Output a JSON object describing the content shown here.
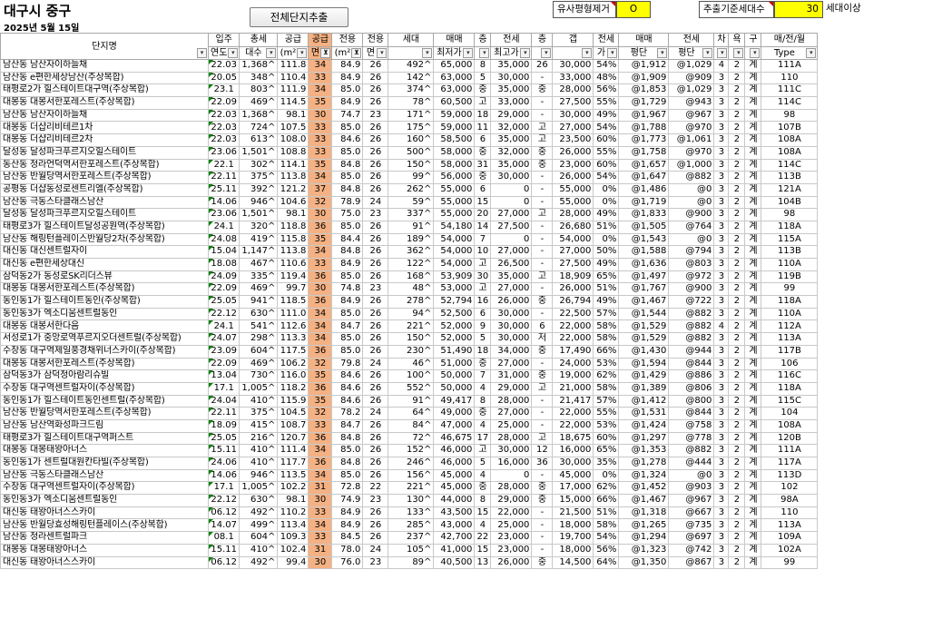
{
  "header": {
    "title": "대구시 중구",
    "date": "2025년 5월 15일",
    "extract_button": "전체단지추출",
    "similar_remove_label": "유사평형제거",
    "similar_remove_value": "O",
    "min_units_label": "추출기준세대수",
    "min_units_value": "30",
    "min_units_unit": "세대이상"
  },
  "colors": {
    "highlight": "#f4b183",
    "yellow": "#ffff00",
    "corner_green": "#008000",
    "corner_red": "#d00000"
  },
  "columns_top": [
    "단지명",
    "입주",
    "총세",
    "공급",
    "공급",
    "전용",
    "전용",
    "세대",
    "매매",
    "층",
    "전세",
    "층",
    "갭",
    "전세",
    "매매",
    "전세",
    "차",
    "욕",
    "구",
    "매/전/월"
  ],
  "columns_bottom": [
    "",
    "연도",
    "대수",
    "(m²",
    "면",
    "(m²",
    "면",
    "",
    "최저가",
    "",
    "최고가",
    "",
    "",
    "가",
    "평단",
    "평단",
    "",
    "",
    "",
    "Type"
  ],
  "rows": [
    [
      "남산동 남산자이하늘채",
      "22.03",
      "1,368^",
      "111.8",
      "34",
      "84.9",
      "26",
      "492^",
      "65,000",
      "8",
      "35,000",
      "26",
      "30,000",
      "54%",
      "@1,912",
      "@1,029",
      "4",
      "2",
      "계",
      "111A"
    ],
    [
      "남산동 e편한세상남산(주상복합)",
      "20.05",
      "348^",
      "110.4",
      "33",
      "84.9",
      "26",
      "142^",
      "63,000",
      "5",
      "30,000",
      "-",
      "33,000",
      "48%",
      "@1,909",
      "@909",
      "3",
      "2",
      "계",
      "110"
    ],
    [
      "태평로2가 힐스테이트대구역(주상복합)",
      "23.1",
      "803^",
      "111.9",
      "34",
      "85.0",
      "26",
      "374^",
      "63,000",
      "중",
      "35,000",
      "중",
      "28,000",
      "56%",
      "@1,853",
      "@1,029",
      "3",
      "2",
      "계",
      "111C"
    ],
    [
      "대봉동 대봉서한포레스트(주상복합)",
      "22.09",
      "469^",
      "114.5",
      "35",
      "84.9",
      "26",
      "78^",
      "60,500",
      "고",
      "33,000",
      "-",
      "27,500",
      "55%",
      "@1,729",
      "@943",
      "3",
      "2",
      "계",
      "114C"
    ],
    [
      "남산동 남산자이하늘채",
      "22.03",
      "1,368^",
      "98.1",
      "30",
      "74.7",
      "23",
      "171^",
      "59,000",
      "18",
      "29,000",
      "-",
      "30,000",
      "49%",
      "@1,967",
      "@967",
      "3",
      "2",
      "계",
      "98"
    ],
    [
      "대봉동 더샵리비테르1차",
      "22.03",
      "724^",
      "107.5",
      "33",
      "85.0",
      "26",
      "175^",
      "59,000",
      "11",
      "32,000",
      "고",
      "27,000",
      "54%",
      "@1,788",
      "@970",
      "3",
      "2",
      "계",
      "107B"
    ],
    [
      "대봉동 더샵리비테르2차",
      "22.03",
      "613^",
      "108.0",
      "33",
      "84.6",
      "26",
      "160^",
      "58,500",
      "6",
      "35,000",
      "고",
      "23,500",
      "60%",
      "@1,773",
      "@1,061",
      "3",
      "2",
      "계",
      "108A"
    ],
    [
      "달성동 달성파크푸르지오힐스테이트",
      "23.06",
      "1,501^",
      "108.8",
      "33",
      "85.0",
      "26",
      "500^",
      "58,000",
      "중",
      "32,000",
      "중",
      "26,000",
      "55%",
      "@1,758",
      "@970",
      "3",
      "2",
      "계",
      "108A"
    ],
    [
      "동산동 청라언덕역서한포레스트(주상복합)",
      "22.1",
      "302^",
      "114.1",
      "35",
      "84.8",
      "26",
      "150^",
      "58,000",
      "31",
      "35,000",
      "중",
      "23,000",
      "60%",
      "@1,657",
      "@1,000",
      "3",
      "2",
      "계",
      "114C"
    ],
    [
      "남산동 반월당역서한포레스트(주상복합)",
      "22.11",
      "375^",
      "113.8",
      "34",
      "85.0",
      "26",
      "99^",
      "56,000",
      "중",
      "30,000",
      "-",
      "26,000",
      "54%",
      "@1,647",
      "@882",
      "3",
      "2",
      "계",
      "113B"
    ],
    [
      "공평동 더샵동성로센트리엘(주상복합)",
      "25.11",
      "392^",
      "121.2",
      "37",
      "84.8",
      "26",
      "262^",
      "55,000",
      "6",
      "0",
      "-",
      "55,000",
      "0%",
      "@1,486",
      "@0",
      "3",
      "2",
      "계",
      "121A"
    ],
    [
      "남산동 극동스타클래스남산",
      "14.06",
      "946^",
      "104.6",
      "32",
      "78.9",
      "24",
      "59^",
      "55,000",
      "15",
      "0",
      "-",
      "55,000",
      "0%",
      "@1,719",
      "@0",
      "3",
      "2",
      "계",
      "104B"
    ],
    [
      "달성동 달성파크푸르지오힐스테이트",
      "23.06",
      "1,501^",
      "98.1",
      "30",
      "75.0",
      "23",
      "337^",
      "55,000",
      "20",
      "27,000",
      "고",
      "28,000",
      "49%",
      "@1,833",
      "@900",
      "3",
      "2",
      "계",
      "98"
    ],
    [
      "태평로3가 힐스테이트달성공원역(주상복합)",
      "24.1",
      "320^",
      "118.8",
      "36",
      "85.0",
      "26",
      "91^",
      "54,180",
      "14",
      "27,500",
      "-",
      "26,680",
      "51%",
      "@1,505",
      "@764",
      "3",
      "2",
      "계",
      "118A"
    ],
    [
      "남산동 해링턴플레이스반월당2차(주상복합)",
      "24.08",
      "419^",
      "115.8",
      "35",
      "84.4",
      "26",
      "189^",
      "54,000",
      "7",
      "0",
      "-",
      "54,000",
      "0%",
      "@1,543",
      "@0",
      "3",
      "2",
      "계",
      "115A"
    ],
    [
      "대신동 대신센트럴자이",
      "15.04",
      "1,147^",
      "113.8",
      "34",
      "84.8",
      "26",
      "362^",
      "54,000",
      "10",
      "27,000",
      "-",
      "27,000",
      "50%",
      "@1,588",
      "@794",
      "3",
      "2",
      "계",
      "113B"
    ],
    [
      "대신동 e편한세상대신",
      "18.08",
      "467^",
      "110.6",
      "33",
      "84.9",
      "26",
      "122^",
      "54,000",
      "고",
      "26,500",
      "-",
      "27,500",
      "49%",
      "@1,636",
      "@803",
      "3",
      "2",
      "계",
      "110A"
    ],
    [
      "삼덕동2가 동성로SK리더스뷰",
      "24.09",
      "335^",
      "119.4",
      "36",
      "85.0",
      "26",
      "168^",
      "53,909",
      "30",
      "35,000",
      "고",
      "18,909",
      "65%",
      "@1,497",
      "@972",
      "3",
      "2",
      "계",
      "119B"
    ],
    [
      "대봉동 대봉서한포레스트(주상복합)",
      "22.09",
      "469^",
      "99.7",
      "30",
      "74.8",
      "23",
      "48^",
      "53,000",
      "고",
      "27,000",
      "-",
      "26,000",
      "51%",
      "@1,767",
      "@900",
      "3",
      "2",
      "계",
      "99"
    ],
    [
      "동인동1가 힐스테이트동인(주상복합)",
      "25.05",
      "941^",
      "118.5",
      "36",
      "84.9",
      "26",
      "278^",
      "52,794",
      "16",
      "26,000",
      "중",
      "26,794",
      "49%",
      "@1,467",
      "@722",
      "3",
      "2",
      "계",
      "118A"
    ],
    [
      "동인동3가 엑소디움센트럴동인",
      "22.12",
      "630^",
      "111.0",
      "34",
      "85.0",
      "26",
      "94^",
      "52,500",
      "6",
      "30,000",
      "-",
      "22,500",
      "57%",
      "@1,544",
      "@882",
      "3",
      "2",
      "계",
      "110A"
    ],
    [
      "대봉동 대봉서한다음",
      "24.1",
      "541^",
      "112.6",
      "34",
      "84.7",
      "26",
      "221^",
      "52,000",
      "9",
      "30,000",
      "6",
      "22,000",
      "58%",
      "@1,529",
      "@882",
      "4",
      "2",
      "계",
      "112A"
    ],
    [
      "서성로1가 중앙로역푸르지오더센트럴(주상복합)",
      "24.07",
      "298^",
      "113.3",
      "34",
      "85.0",
      "26",
      "150^",
      "52,000",
      "5",
      "30,000",
      "저",
      "22,000",
      "58%",
      "@1,529",
      "@882",
      "3",
      "2",
      "계",
      "113A"
    ],
    [
      "수창동 대구역제일풍경채위너스카이(주상복합)",
      "23.09",
      "604^",
      "117.5",
      "36",
      "85.0",
      "26",
      "230^",
      "51,490",
      "18",
      "34,000",
      "중",
      "17,490",
      "66%",
      "@1,430",
      "@944",
      "3",
      "2",
      "계",
      "117B"
    ],
    [
      "대봉동 대봉서한포레스트(주상복합)",
      "22.09",
      "469^",
      "106.2",
      "32",
      "79.8",
      "24",
      "46^",
      "51,000",
      "중",
      "27,000",
      "-",
      "24,000",
      "53%",
      "@1,594",
      "@844",
      "3",
      "2",
      "계",
      "106"
    ],
    [
      "삼덕동3가 삼덕청아람리슈빌",
      "13.04",
      "730^",
      "116.0",
      "35",
      "84.6",
      "26",
      "100^",
      "50,000",
      "7",
      "31,000",
      "중",
      "19,000",
      "62%",
      "@1,429",
      "@886",
      "3",
      "2",
      "계",
      "116C"
    ],
    [
      "수창동 대구역센트럴자이(주상복합)",
      "17.1",
      "1,005^",
      "118.2",
      "36",
      "84.6",
      "26",
      "552^",
      "50,000",
      "4",
      "29,000",
      "고",
      "21,000",
      "58%",
      "@1,389",
      "@806",
      "3",
      "2",
      "계",
      "118A"
    ],
    [
      "동인동1가 힐스테이트동인센트럴(주상복합)",
      "24.04",
      "410^",
      "115.9",
      "35",
      "84.6",
      "26",
      "91^",
      "49,417",
      "8",
      "28,000",
      "-",
      "21,417",
      "57%",
      "@1,412",
      "@800",
      "3",
      "2",
      "계",
      "115C"
    ],
    [
      "남산동 반월당역서한포레스트(주상복합)",
      "22.11",
      "375^",
      "104.5",
      "32",
      "78.2",
      "24",
      "64^",
      "49,000",
      "중",
      "27,000",
      "-",
      "22,000",
      "55%",
      "@1,531",
      "@844",
      "3",
      "2",
      "계",
      "104"
    ],
    [
      "남산동 남산역화성파크드림",
      "18.09",
      "415^",
      "108.7",
      "33",
      "84.7",
      "26",
      "84^",
      "47,000",
      "4",
      "25,000",
      "-",
      "22,000",
      "53%",
      "@1,424",
      "@758",
      "3",
      "2",
      "계",
      "108A"
    ],
    [
      "태평로3가 힐스테이트대구역퍼스트",
      "25.05",
      "216^",
      "120.7",
      "36",
      "84.8",
      "26",
      "72^",
      "46,675",
      "17",
      "28,000",
      "고",
      "18,675",
      "60%",
      "@1,297",
      "@778",
      "3",
      "2",
      "계",
      "120B"
    ],
    [
      "대봉동 대봉태왕아너스",
      "15.11",
      "410^",
      "111.4",
      "34",
      "85.0",
      "26",
      "152^",
      "46,000",
      "고",
      "30,000",
      "12",
      "16,000",
      "65%",
      "@1,353",
      "@882",
      "3",
      "2",
      "계",
      "111A"
    ],
    [
      "동인동1가 센트럴대원칸타빌(주상복합)",
      "24.06",
      "410^",
      "117.7",
      "36",
      "84.8",
      "26",
      "246^",
      "46,000",
      "5",
      "16,000",
      "36",
      "30,000",
      "35%",
      "@1,278",
      "@444",
      "3",
      "2",
      "계",
      "117A"
    ],
    [
      "남산동 극동스타클래스남산",
      "14.06",
      "946^",
      "113.5",
      "34",
      "85.0",
      "26",
      "156^",
      "45,000",
      "4",
      "0",
      "-",
      "45,000",
      "0%",
      "@1,324",
      "@0",
      "3",
      "2",
      "계",
      "113D"
    ],
    [
      "수창동 대구역센트럴자이(주상복합)",
      "17.1",
      "1,005^",
      "102.2",
      "31",
      "72.8",
      "22",
      "221^",
      "45,000",
      "중",
      "28,000",
      "중",
      "17,000",
      "62%",
      "@1,452",
      "@903",
      "3",
      "2",
      "계",
      "102"
    ],
    [
      "동인동3가 엑소디움센트럴동인",
      "22.12",
      "630^",
      "98.1",
      "30",
      "74.9",
      "23",
      "130^",
      "44,000",
      "8",
      "29,000",
      "중",
      "15,000",
      "66%",
      "@1,467",
      "@967",
      "3",
      "2",
      "계",
      "98A"
    ],
    [
      "대신동 태왕아너스스카이",
      "06.12",
      "492^",
      "110.2",
      "33",
      "84.9",
      "26",
      "133^",
      "43,500",
      "15",
      "22,000",
      "-",
      "21,500",
      "51%",
      "@1,318",
      "@667",
      "3",
      "2",
      "계",
      "110"
    ],
    [
      "남산동 반월당효성해링턴플레이스(주상복합)",
      "14.07",
      "499^",
      "113.4",
      "34",
      "84.9",
      "26",
      "285^",
      "43,000",
      "4",
      "25,000",
      "-",
      "18,000",
      "58%",
      "@1,265",
      "@735",
      "3",
      "2",
      "계",
      "113A"
    ],
    [
      "남산동 청라센트럴파크",
      "08.1",
      "604^",
      "109.3",
      "33",
      "84.5",
      "26",
      "237^",
      "42,700",
      "22",
      "23,000",
      "-",
      "19,700",
      "54%",
      "@1,294",
      "@697",
      "3",
      "2",
      "계",
      "109A"
    ],
    [
      "대봉동 대봉태왕아너스",
      "15.11",
      "410^",
      "102.4",
      "31",
      "78.0",
      "24",
      "105^",
      "41,000",
      "15",
      "23,000",
      "-",
      "18,000",
      "56%",
      "@1,323",
      "@742",
      "3",
      "2",
      "계",
      "102A"
    ],
    [
      "대신동 태왕아너스스카이",
      "06.12",
      "492^",
      "99.4",
      "30",
      "76.0",
      "23",
      "89^",
      "40,500",
      "13",
      "26,000",
      "중",
      "14,500",
      "64%",
      "@1,350",
      "@867",
      "3",
      "2",
      "계",
      "99"
    ]
  ]
}
